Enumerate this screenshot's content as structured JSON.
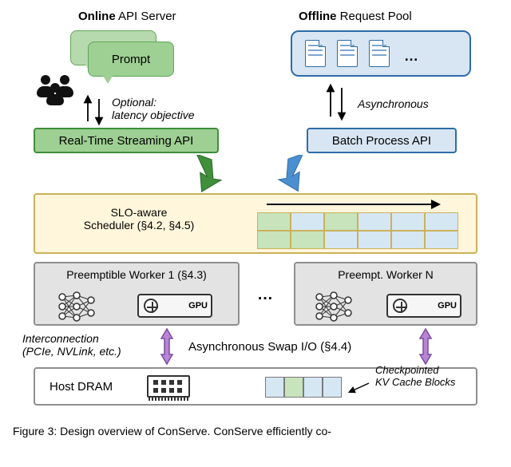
{
  "headers": {
    "online_prefix": "Online",
    "online": "API Server",
    "offline_prefix": "Offline",
    "offline": "Request Pool"
  },
  "prompt_label": "Prompt",
  "pool_ellipsis": "…",
  "annotations": {
    "optional": "Optional:",
    "latency": "latency objective",
    "async": "Asynchronous"
  },
  "api": {
    "realtime": "Real-Time Streaming API",
    "batch": "Batch Process API"
  },
  "scheduler": {
    "line1": "SLO-aware",
    "line2": "Scheduler (§4.2, §4.5)"
  },
  "workers": {
    "w1": "Preemptible Worker 1 (§4.3)",
    "wn": "Preempt. Worker N",
    "gpu_label": "GPU"
  },
  "between_workers_ellipsis": "…",
  "interconnect": {
    "line1": "Interconnection",
    "line2": "(PCIe, NVLink, etc.)"
  },
  "swap_line": "Asynchronous Swap I/O (§4.4)",
  "host_dram": "Host DRAM",
  "kv_caption": {
    "line1": "Checkpointed",
    "line2": "KV Cache Blocks"
  },
  "caption": "Figure 3: Design overview of ConServe. ConServe efficiently co-"
}
